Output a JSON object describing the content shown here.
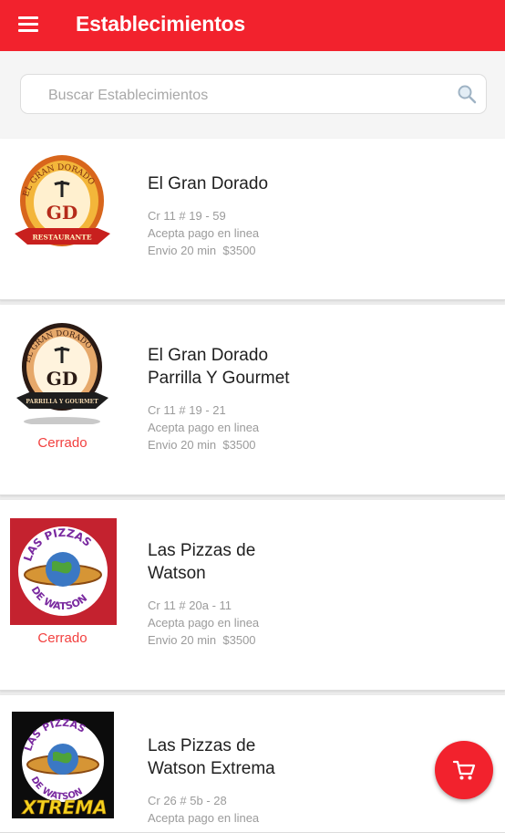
{
  "header": {
    "title": "Establecimientos"
  },
  "search": {
    "placeholder": "Buscar Establecimientos",
    "value": ""
  },
  "establishments": [
    {
      "name": "El Gran Dorado",
      "address": "Cr 11 # 19 - 59",
      "payment": "Acepta pago en linea",
      "delivery": "Envio 20 min  $3500",
      "status": ""
    },
    {
      "name": "El Gran Dorado Parrilla Y Gourmet",
      "address": "Cr 11 # 19 - 21",
      "payment": "Acepta pago en linea",
      "delivery": "Envio 20 min  $3500",
      "status": "Cerrado"
    },
    {
      "name": "Las Pizzas de Watson",
      "address": "Cr 11 # 20a - 11",
      "payment": "Acepta pago en linea",
      "delivery": "Envio 20 min  $3500",
      "status": "Cerrado"
    },
    {
      "name": "Las Pizzas de Watson Extrema",
      "address": "Cr 26 # 5b - 28",
      "payment": "Acepta pago en linea",
      "delivery": "",
      "status": ""
    }
  ],
  "logos": {
    "gran_dorado": {
      "arc": "EL GRAN DORADO",
      "mono": "GD",
      "ribbon": "RESTAURANTE"
    },
    "parrilla": {
      "arc": "EL GRAN DORADO",
      "mono": "GD",
      "ribbon": "PARRILLA Y GOURMET"
    },
    "pizzas": {
      "top": "LAS PIZZAS",
      "bottom": "DE WATSON"
    },
    "xtrema": {
      "top": "LAS PIZZAS",
      "bottom": "DE WATSON",
      "banner": "XTREMA"
    }
  },
  "colors": {
    "primary": "#f2222d",
    "closed": "#f2403f",
    "pizza_bg": "#c4222f"
  },
  "icons": {
    "menu": "menu-icon",
    "search": "search-icon",
    "cart": "cart-icon"
  }
}
